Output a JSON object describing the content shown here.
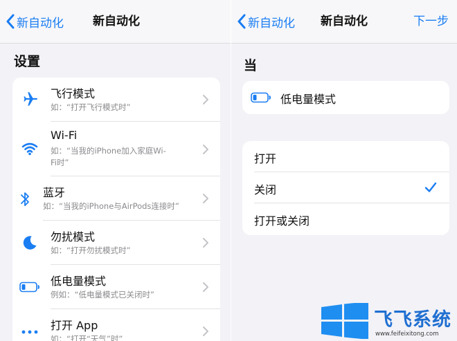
{
  "left": {
    "nav": {
      "back_label": "新自动化",
      "title": "新自动化"
    },
    "section_title": "设置",
    "items": [
      {
        "title": "飞行模式",
        "subtitle": "如：“打开飞行模式时”",
        "icon": "airplane-icon"
      },
      {
        "title": "Wi-Fi",
        "subtitle": "如：“当我的iPhone加入家庭Wi-Fi时”",
        "icon": "wifi-icon"
      },
      {
        "title": "蓝牙",
        "subtitle": "如：“当我的iPhone与AirPods连接时”",
        "icon": "bluetooth-icon"
      },
      {
        "title": "勿扰模式",
        "subtitle": "如：“打开勿扰模式时”",
        "icon": "moon-icon"
      },
      {
        "title": "低电量模式",
        "subtitle": "例如：“低电量模式已关闭时”",
        "icon": "battery-icon"
      },
      {
        "title": "打开 App",
        "subtitle": "如：“打开“天气”时”",
        "icon": "more-icon"
      }
    ]
  },
  "right": {
    "nav": {
      "back_label": "新自动化",
      "title": "新自动化",
      "next_label": "下一步"
    },
    "section_title": "当",
    "trigger": {
      "label": "低电量模式",
      "icon": "battery-icon"
    },
    "options": [
      {
        "label": "打开",
        "selected": false
      },
      {
        "label": "关闭",
        "selected": true
      },
      {
        "label": "打开或关闭",
        "selected": false
      }
    ]
  },
  "watermark": {
    "text": "飞飞系统",
    "url": "www.feifeixitong.com"
  },
  "colors": {
    "accent": "#1a7df2",
    "background": "#f2f2f7",
    "card": "#ffffff",
    "secondary_text": "#8a8a8e"
  }
}
